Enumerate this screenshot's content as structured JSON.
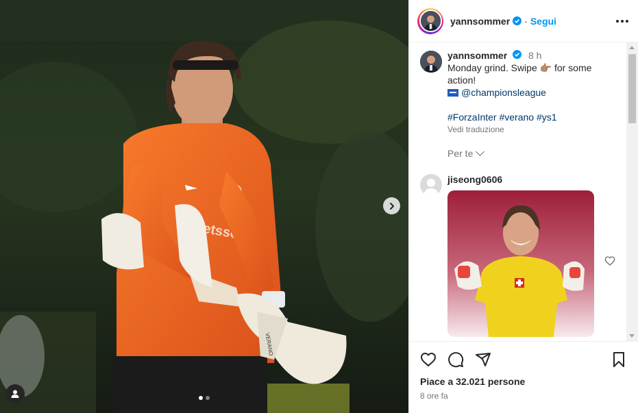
{
  "post": {
    "username": "yannsommer",
    "verified": true,
    "follow_label": "Segui",
    "separator": "·",
    "slides": {
      "current": 1,
      "total": 2
    }
  },
  "caption": {
    "username": "yannsommer",
    "time": "8 h",
    "line1": "Monday grind. Swipe 👉🏽 for some action!",
    "mention": "@championsleague",
    "hashtags": "#ForzaInter #verano #ys1",
    "translate_label": "Vedi traduzione"
  },
  "per_te_label": "Per te",
  "comment": {
    "username": "jiseong0606"
  },
  "footer": {
    "likes_text": "Piace a 32.021 persone",
    "time_ago": "8 ore fa"
  },
  "colors": {
    "accent": "#0095f6",
    "jersey_orange": "#f26a1f",
    "comment_bg": "#a52a3e",
    "swiss_yellow": "#f0d21e"
  },
  "icons": {
    "heart": "heart-icon",
    "comment": "comment-icon",
    "share": "share-icon",
    "save": "bookmark-icon",
    "more": "more-options-icon",
    "next": "chevron-right-icon",
    "tag": "user-tag-icon",
    "verified": "verified-badge-icon"
  }
}
